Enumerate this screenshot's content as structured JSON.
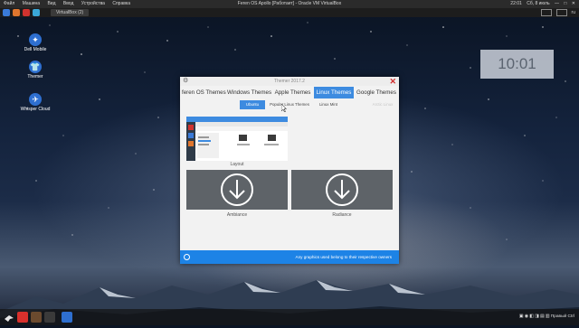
{
  "vm_menubar": {
    "menu_items": [
      "Файл",
      "Машина",
      "Вид",
      "Ввод",
      "Устройства",
      "Справка"
    ],
    "title": "Feren OS Apollo [Работает] - Oracle VM VirtualBox",
    "time": "22:01",
    "date": "Сб, 8 июль"
  },
  "panel": {
    "task_label": "VirtualBox (2)",
    "keyboard": "ru"
  },
  "desktop_icons": [
    {
      "label": "Dell Mobile",
      "icon": "app-icon"
    },
    {
      "label": "Themer",
      "icon": "shirt-icon"
    },
    {
      "label": "Whisper Cloud",
      "icon": "bird-icon"
    }
  ],
  "clock_widget": {
    "time": "10:01"
  },
  "window": {
    "title": "Themer 2017.2",
    "tabs": [
      "feren OS Themes",
      "Windows Themes",
      "Apple Themes",
      "Linux Themes",
      "Google Themes"
    ],
    "active_tab": "Linux Themes",
    "subtabs": [
      "Ubuntu",
      "Popular Linux Themes",
      "Linux Mint",
      "Arctic Linux"
    ],
    "active_subtab": "Ubuntu",
    "themes": [
      {
        "name": "Layout"
      },
      {
        "name": "Ambiance"
      },
      {
        "name": "Radiance"
      }
    ],
    "footer_text": "Any graphics used belong to their respective owners"
  },
  "taskbar": {
    "status": "Правый Ctrl"
  },
  "colors": {
    "accent": "#3d8be0",
    "footer": "#1d83e6",
    "close": "#d02c2c"
  }
}
